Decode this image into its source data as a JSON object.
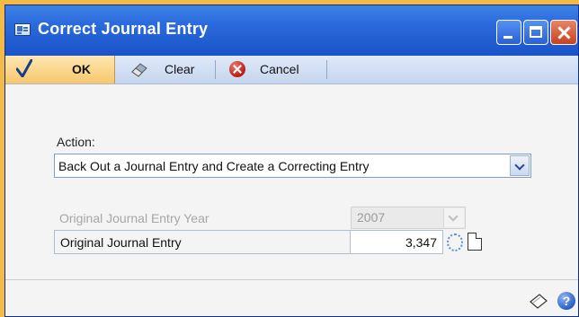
{
  "window": {
    "title": "Correct Journal Entry"
  },
  "toolbar": {
    "ok_label": "OK",
    "clear_label": "Clear",
    "cancel_label": "Cancel"
  },
  "form": {
    "action_label": "Action:",
    "action_value": "Back Out a Journal Entry and Create a Correcting Entry",
    "year_label": "Original Journal Entry Year",
    "year_value": "2007",
    "journal_entry_label": "Original Journal Entry",
    "journal_entry_value": "3,347"
  },
  "footer": {
    "help_glyph": "?"
  },
  "icons": [
    "window-icon",
    "minimize-icon",
    "maximize-icon",
    "close-icon",
    "checkmark-icon",
    "eraser-icon",
    "cancel-icon",
    "chevron-down-icon",
    "lookup-icon",
    "note-icon",
    "help-icon"
  ],
  "colors": {
    "titlebar": "#2c6bdd",
    "ok_button": "#f7c76b",
    "background": "#f4f4f4",
    "outer": "#f6b941"
  }
}
